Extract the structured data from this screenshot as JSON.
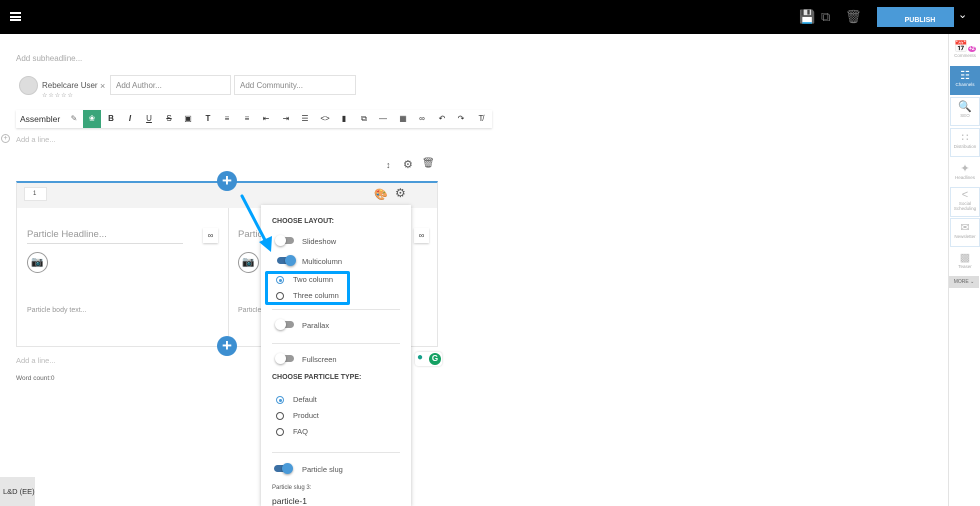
{
  "topbar": {
    "publish_label": "PUBLISH"
  },
  "sidebar": {
    "items": [
      {
        "label": "Comments",
        "badge": "+2"
      },
      {
        "label": "Channels"
      },
      {
        "label": "SEO"
      },
      {
        "label": "Distribution"
      },
      {
        "label": "Headlines"
      },
      {
        "label": "Social Scheduling"
      },
      {
        "label": "Newsletter"
      },
      {
        "label": "Teaser"
      }
    ],
    "more_label": "MORE"
  },
  "editor": {
    "subheadline_placeholder": "Add subheadline...",
    "author_name": "Rebelcare User",
    "author_rating": "☆☆☆☆☆",
    "remove_author": "×",
    "add_author_placeholder": "Add Author...",
    "add_community_placeholder": "Add Community...",
    "add_line": "Add a line...",
    "add_line_bottom": "Add a line...",
    "word_count": "Word count:0"
  },
  "toolbar": {
    "assembler_label": "Assembler"
  },
  "block": {
    "number": "1",
    "col1_headline": "Particle Headline...",
    "col1_body": "Particle body text...",
    "col2_headline": "Particle Headline...",
    "col2_body": "Particle body text..."
  },
  "popup": {
    "layout_title": "CHOOSE LAYOUT:",
    "slideshow": "Slideshow",
    "multicolumn": "Multicolumn",
    "two_column": "Two column",
    "three_column": "Three column",
    "parallax": "Parallax",
    "fullscreen": "Fullscreen",
    "particle_type_title": "CHOOSE PARTICLE TYPE:",
    "default": "Default",
    "product": "Product",
    "faq": "FAQ",
    "particle_slug": "Particle slug",
    "slug_label": "Particle slug 3:",
    "slug_value": "particle-1"
  },
  "footer": {
    "locale": "L&D (EE)"
  },
  "colors": {
    "accent": "#4a9ad8",
    "highlight": "#00a2ff",
    "ai_button": "#3aa57a"
  }
}
